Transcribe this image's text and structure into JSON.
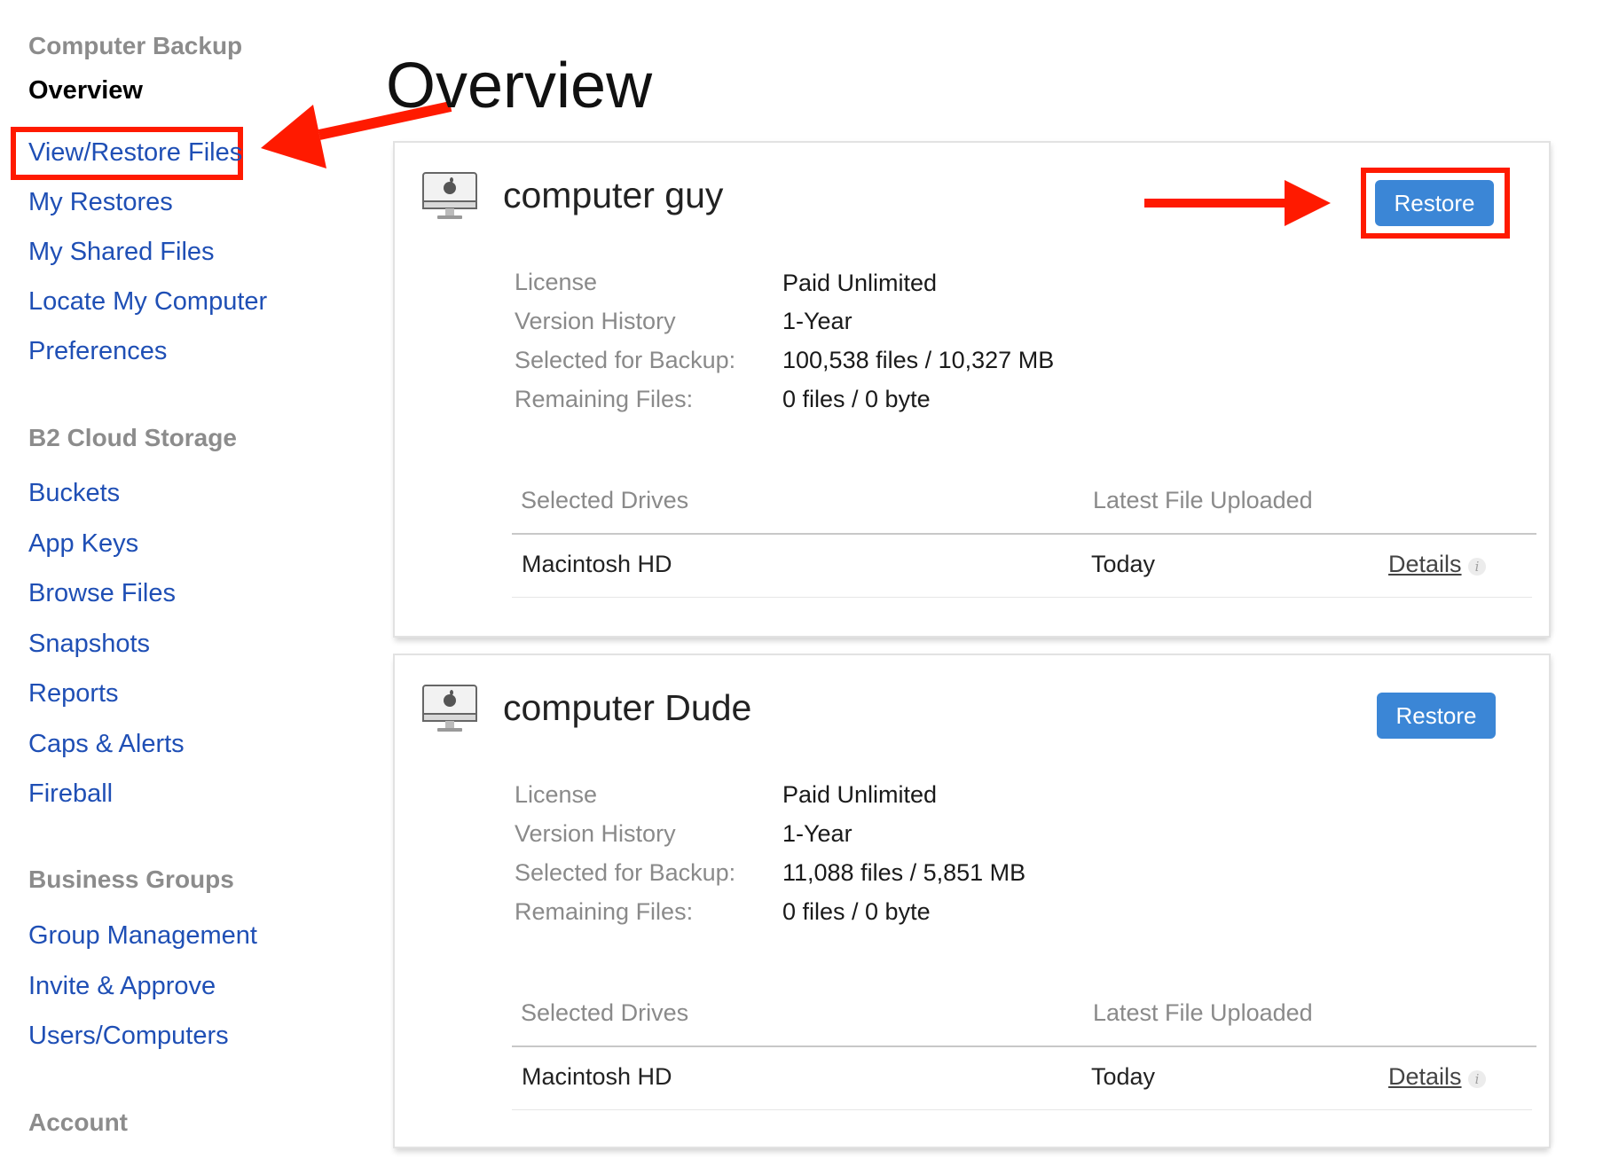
{
  "page": {
    "title": "Overview"
  },
  "sidebar": {
    "sections": [
      {
        "title": "Computer Backup",
        "items": [
          {
            "label": "Overview",
            "active": true
          },
          {
            "label": "View/Restore Files",
            "highlighted": true
          },
          {
            "label": "My Restores"
          },
          {
            "label": "My Shared Files"
          },
          {
            "label": "Locate My Computer"
          },
          {
            "label": "Preferences"
          }
        ]
      },
      {
        "title": "B2 Cloud Storage",
        "items": [
          {
            "label": "Buckets"
          },
          {
            "label": "App Keys"
          },
          {
            "label": "Browse Files"
          },
          {
            "label": "Snapshots"
          },
          {
            "label": "Reports"
          },
          {
            "label": "Caps & Alerts"
          },
          {
            "label": "Fireball"
          }
        ]
      },
      {
        "title": "Business Groups",
        "items": [
          {
            "label": "Group Management"
          },
          {
            "label": "Invite & Approve"
          },
          {
            "label": "Users/Computers"
          }
        ]
      },
      {
        "title": "Account",
        "items": []
      }
    ]
  },
  "labels": {
    "restore": "Restore",
    "license": "License",
    "version_history": "Version History",
    "selected_for_backup": "Selected for Backup:",
    "remaining_files": "Remaining Files:",
    "selected_drives": "Selected Drives",
    "latest_file_uploaded": "Latest File Uploaded",
    "details": "Details",
    "info_glyph": "i"
  },
  "computers": [
    {
      "name": "computer guy",
      "license": "Paid Unlimited",
      "version_history": "1-Year",
      "selected_for_backup": "100,538 files / 10,327 MB",
      "remaining_files": "0 files / 0 byte",
      "drive": "Macintosh HD",
      "latest_upload": "Today",
      "restore_highlighted": true
    },
    {
      "name": "computer Dude",
      "license": "Paid Unlimited",
      "version_history": "1-Year",
      "selected_for_backup": "11,088 files / 5,851 MB",
      "remaining_files": "0 files / 0 byte",
      "drive": "Macintosh HD",
      "latest_upload": "Today",
      "restore_highlighted": false
    }
  ],
  "colors": {
    "accent_blue": "#3b86d6",
    "link_blue": "#1f4fb5",
    "annotation_red": "#ff1a00",
    "section_gray": "#8c8c8c"
  },
  "icons": {
    "computer": "imac-computer-icon",
    "info": "info-icon",
    "annotation_arrow": "red-arrow-annotation"
  }
}
